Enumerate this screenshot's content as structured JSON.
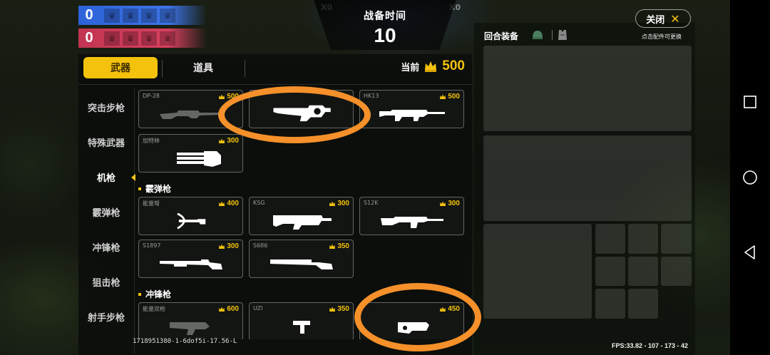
{
  "scoreboard": {
    "blue_score": "0",
    "red_score": "0"
  },
  "timer": {
    "title": "战备时间",
    "value": "10",
    "left_tag": "X0",
    "right_tag": "X0"
  },
  "tabs": {
    "weapons": "武器",
    "items": "道具"
  },
  "balance": {
    "label": "当前",
    "value": "500"
  },
  "categories": [
    {
      "label": "突击步枪",
      "active": false
    },
    {
      "label": "特殊武器",
      "active": false
    },
    {
      "label": "机枪",
      "active": true
    },
    {
      "label": "霰弹枪",
      "active": false
    },
    {
      "label": "冲锋枪",
      "active": false
    },
    {
      "label": "狙击枪",
      "active": false
    },
    {
      "label": "射手步枪",
      "active": false
    }
  ],
  "sections": {
    "shotgun": "霰弹枪",
    "smg": "冲锋枪"
  },
  "weapons": {
    "mg_row1": [
      {
        "name": "DP-28",
        "price": "500",
        "icon": "lmg-icon"
      },
      {
        "name": "",
        "price": "",
        "icon": "heavy-gun-icon"
      },
      {
        "name": "HK13",
        "price": "500",
        "icon": "lmg-icon"
      }
    ],
    "mg_row2": [
      {
        "name": "加特林",
        "price": "300",
        "icon": "gatling-icon"
      }
    ],
    "shotgun_row1": [
      {
        "name": "能量弩",
        "price": "400",
        "icon": "crossbow-icon"
      },
      {
        "name": "KSG",
        "price": "300",
        "icon": "shotgun-icon"
      },
      {
        "name": "S12K",
        "price": "300",
        "icon": "rifle-icon"
      }
    ],
    "shotgun_row2": [
      {
        "name": "S1897",
        "price": "300",
        "icon": "pump-shotgun-icon"
      },
      {
        "name": "S686",
        "price": "350",
        "icon": "double-barrel-icon"
      }
    ],
    "smg_row1": [
      {
        "name": "能量双枪",
        "price": "600",
        "icon": "dual-gun-icon"
      },
      {
        "name": "UZI",
        "price": "350",
        "icon": "uzi-icon"
      },
      {
        "name": "",
        "price": "450",
        "icon": "p90-icon"
      }
    ]
  },
  "build_id": "1718951380-1-6dof5i-17.56-L",
  "loadout": {
    "title": "回合装备"
  },
  "close": {
    "label": "关闭"
  },
  "hint": "点击配件可更换",
  "fps": "FPS:33.82 - 107 - 173 - 42",
  "colors": {
    "accent": "#f4c20d",
    "blue_team": "#2d62d8",
    "red_team": "#c23552",
    "annotation": "#f5902a"
  }
}
